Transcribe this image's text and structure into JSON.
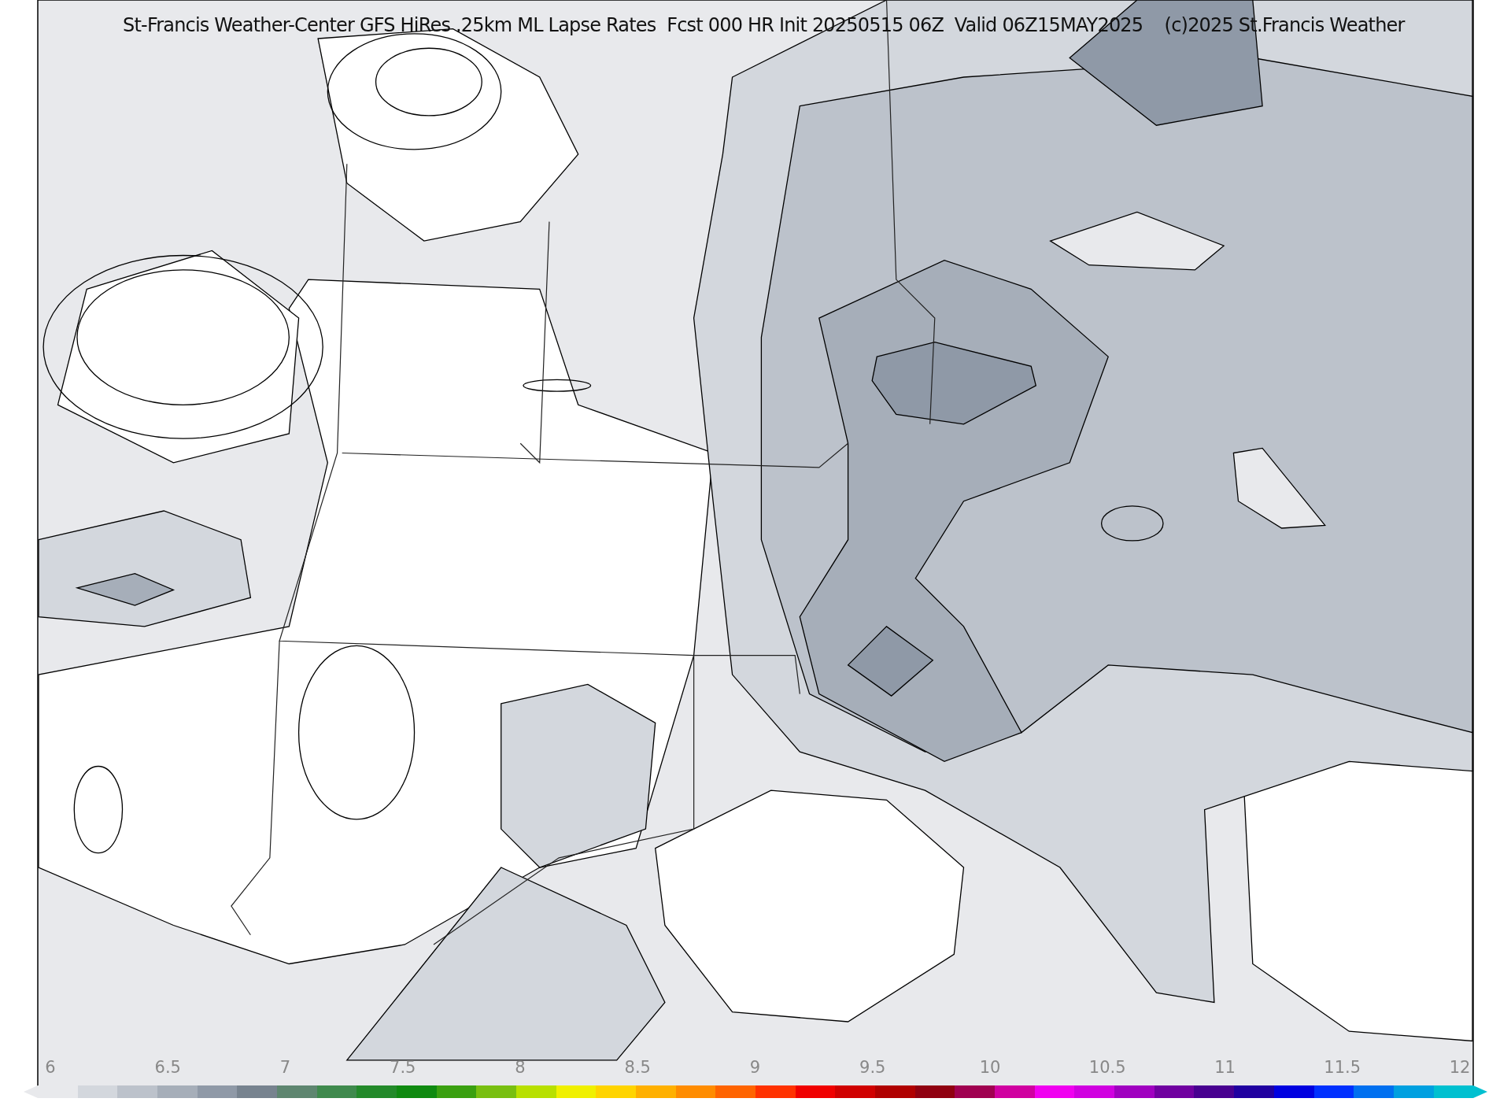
{
  "title": "St-Francis Weather-Center GFS HiRes .25km ML Lapse Rates  Fcst 000 HR Init 20250515 06Z  Valid 06Z15MAY2025    (c)2025 St.Francis Weather",
  "colorbar": {
    "ticks": [
      "6",
      "6.5",
      "7",
      "7.5",
      "8",
      "8.5",
      "9",
      "9.5",
      "10",
      "10.5",
      "11",
      "11.5",
      "12"
    ],
    "bins": [
      {
        "color": "#e8e9ec"
      },
      {
        "color": "#d3d7dd"
      },
      {
        "color": "#bcc2cb"
      },
      {
        "color": "#a6aeb9"
      },
      {
        "color": "#8f99a7"
      },
      {
        "color": "#77838f"
      },
      {
        "color": "#5e8670"
      },
      {
        "color": "#3f8a4d"
      },
      {
        "color": "#238a2a"
      },
      {
        "color": "#0f8a10"
      },
      {
        "color": "#3aa010"
      },
      {
        "color": "#78bf10"
      },
      {
        "color": "#b8e000"
      },
      {
        "color": "#f0f000"
      },
      {
        "color": "#ffd400"
      },
      {
        "color": "#ffb000"
      },
      {
        "color": "#ff8c00"
      },
      {
        "color": "#ff6400"
      },
      {
        "color": "#ff3200"
      },
      {
        "color": "#f00000"
      },
      {
        "color": "#d00000"
      },
      {
        "color": "#b00000"
      },
      {
        "color": "#900010"
      },
      {
        "color": "#a00050"
      },
      {
        "color": "#d000a0"
      },
      {
        "color": "#f000f0"
      },
      {
        "color": "#d000e0"
      },
      {
        "color": "#a000c0"
      },
      {
        "color": "#7000a0"
      },
      {
        "color": "#480090"
      },
      {
        "color": "#2000a0"
      },
      {
        "color": "#0000e0"
      },
      {
        "color": "#0030ff"
      },
      {
        "color": "#0070f0"
      },
      {
        "color": "#00a0e0"
      },
      {
        "color": "#00c0d0"
      }
    ]
  }
}
